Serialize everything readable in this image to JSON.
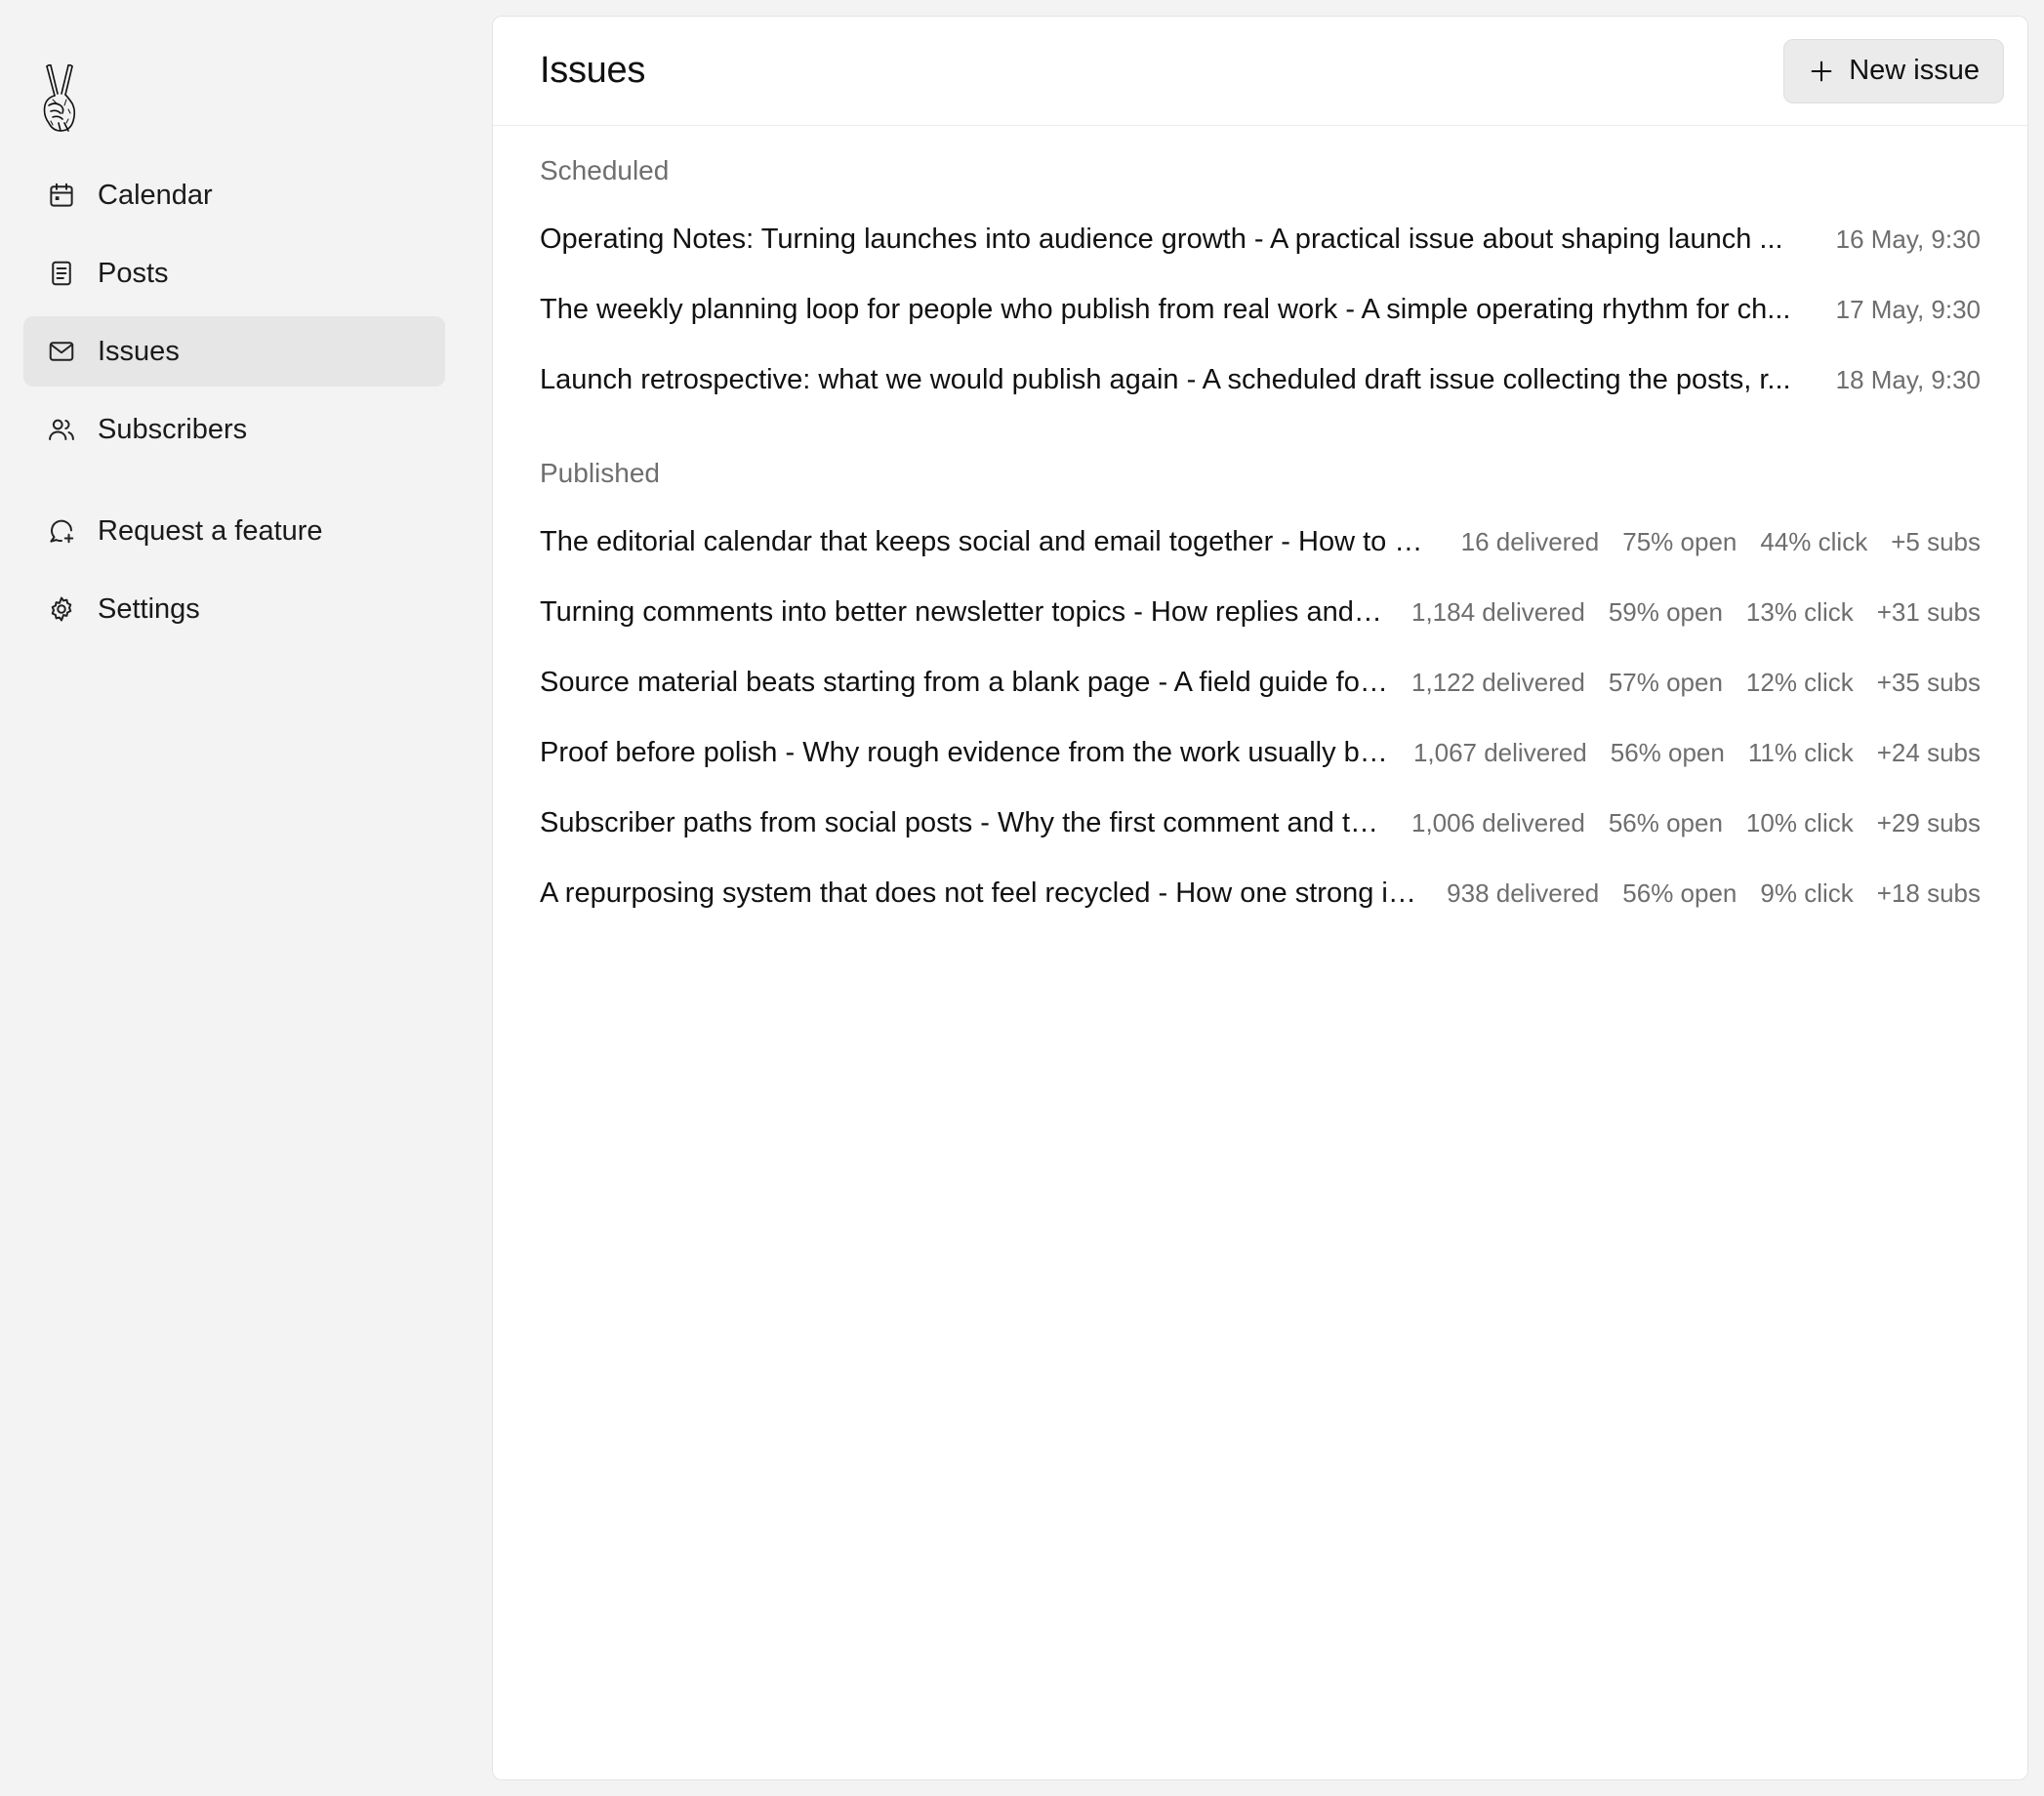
{
  "sidebar": {
    "items": [
      {
        "label": "Calendar",
        "icon": "calendar-icon"
      },
      {
        "label": "Posts",
        "icon": "document-icon"
      },
      {
        "label": "Issues",
        "icon": "mail-icon",
        "active": true
      },
      {
        "label": "Subscribers",
        "icon": "users-icon"
      },
      {
        "label": "Request a feature",
        "icon": "chat-plus-icon"
      },
      {
        "label": "Settings",
        "icon": "gear-icon"
      }
    ]
  },
  "header": {
    "title": "Issues",
    "new_button_label": "New issue"
  },
  "scheduled": {
    "title": "Scheduled",
    "rows": [
      {
        "title": "Operating Notes: Turning launches into audience growth - A practical issue about shaping launch ...",
        "date": "16 May, 9:30"
      },
      {
        "title": "The weekly planning loop for people who publish from real work - A simple operating rhythm for ch...",
        "date": "17 May, 9:30"
      },
      {
        "title": "Launch retrospective: what we would publish again - A scheduled draft issue collecting the posts, r...",
        "date": "18 May, 9:30"
      }
    ]
  },
  "published": {
    "title": "Published",
    "rows": [
      {
        "title": "The editorial calendar that keeps social and email together - How to pl...",
        "delivered": "16 delivered",
        "open": "75% open",
        "click": "44% click",
        "subs": "+5 subs"
      },
      {
        "title": "Turning comments into better newsletter topics - How replies and q...",
        "delivered": "1,184 delivered",
        "open": "59% open",
        "click": "13% click",
        "subs": "+31 subs"
      },
      {
        "title": "Source material beats starting from a blank page - A field guide for ...",
        "delivered": "1,122 delivered",
        "open": "57% open",
        "click": "12% click",
        "subs": "+35 subs"
      },
      {
        "title": "Proof before polish - Why rough evidence from the work usually be...",
        "delivered": "1,067 delivered",
        "open": "56% open",
        "click": "11% click",
        "subs": "+24 subs"
      },
      {
        "title": "Subscriber paths from social posts - Why the first comment and th...",
        "delivered": "1,006 delivered",
        "open": "56% open",
        "click": "10% click",
        "subs": "+29 subs"
      },
      {
        "title": "A repurposing system that does not feel recycled - How one strong id...",
        "delivered": "938 delivered",
        "open": "56% open",
        "click": "9% click",
        "subs": "+18 subs"
      }
    ]
  }
}
